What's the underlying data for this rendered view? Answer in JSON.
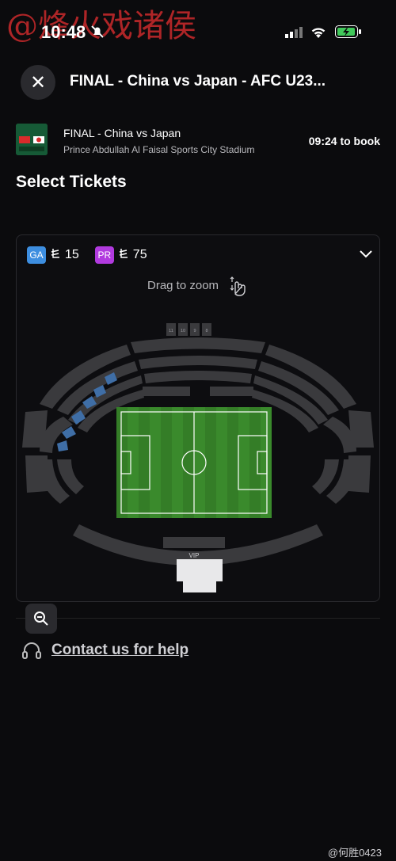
{
  "watermark": "@烽火戏诸侯",
  "status_bar": {
    "time": "10:48"
  },
  "header": {
    "title": "FINAL - China vs Japan  - AFC U23..."
  },
  "event": {
    "name": "FINAL - China vs Japan",
    "venue": "Prince Abdullah Al Faisal Sports City Stadium",
    "countdown": "09:24 to book"
  },
  "section_title": "Select Tickets",
  "legend": [
    {
      "code": "GA",
      "price": "15",
      "color": "#3d8ee0"
    },
    {
      "code": "PR",
      "price": "75",
      "color": "#b13adf"
    }
  ],
  "currency_symbol": "⃁",
  "map_hint": "Drag to zoom",
  "stadium": {
    "top_block": [
      "11",
      "10",
      "9",
      "8"
    ],
    "vip_label": "VIP"
  },
  "help": {
    "label": "Contact us for help"
  },
  "weibo_tag": "@何胜0423",
  "icons": {
    "close": "close-icon",
    "chevron": "chevron-down-icon",
    "zoom_out": "zoom-out-icon",
    "headset": "headset-icon",
    "drag": "hand-drag-icon"
  }
}
